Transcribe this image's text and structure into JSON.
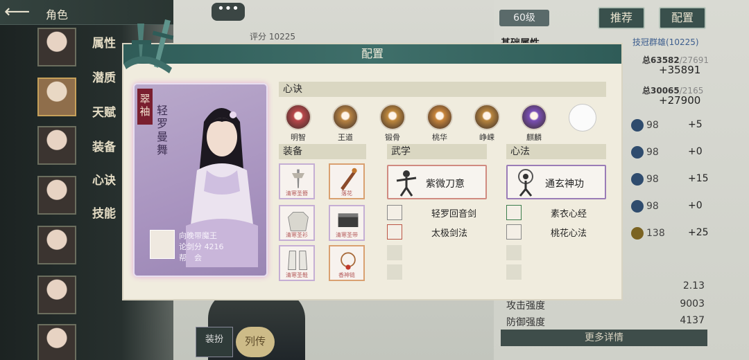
{
  "topbar": {
    "back": "⟵",
    "title": "角色"
  },
  "side_tabs": [
    "属性",
    "潜质",
    "天赋",
    "装备",
    "心诀",
    "技能"
  ],
  "chat": "•••",
  "score_text": "评分 10225",
  "right": {
    "level": "60级",
    "recommend": "推荐",
    "config": "配置",
    "base_attr": "基础属性",
    "champion": "技冠群雄(10225)",
    "total1": "总63582",
    "total1_suffix": "/27691",
    "big1": "+35891",
    "total2": "总30065",
    "total2_suffix": "/2165",
    "big2": "+27900",
    "rows": [
      {
        "val": "98",
        "plus": "+5"
      },
      {
        "val": "98",
        "plus": "+0"
      },
      {
        "val": "98",
        "plus": "+15"
      },
      {
        "val": "98",
        "plus": "+0"
      },
      {
        "val": "138",
        "plus": "+25"
      }
    ],
    "stats": [
      {
        "label": "",
        "value": "2.13"
      },
      {
        "label": "攻击强度",
        "value": "9003"
      },
      {
        "label": "防御强度",
        "value": "4137"
      }
    ],
    "more": "更多详情"
  },
  "bottom": {
    "costume": "装扮",
    "bio": "列传"
  },
  "modal": {
    "title": "配置",
    "character": {
      "title_tag": "翠袖",
      "name": "轻罗曼舞",
      "owner": "向晚带魔王",
      "score": "论剑分 4216",
      "guild": "帮　会"
    },
    "heart_section": "心诀",
    "hearts": [
      {
        "label": "明智",
        "color": "#b8474a"
      },
      {
        "label": "王道",
        "color": "#b98443"
      },
      {
        "label": "锻骨",
        "color": "#c0893d"
      },
      {
        "label": "桃华",
        "color": "#c7843b"
      },
      {
        "label": "峥嵘",
        "color": "#b8853e"
      },
      {
        "label": "麒麟",
        "color": "#7a4fb5"
      }
    ],
    "equip_section": "装备",
    "equipment": [
      {
        "label": "清寒圣簪",
        "icon": "hairpin-icon"
      },
      {
        "label": "落花",
        "icon": "flute-icon"
      },
      {
        "label": "清寒圣衫",
        "icon": "robe-icon"
      },
      {
        "label": "清寒圣带",
        "icon": "belt-icon"
      },
      {
        "label": "清寒圣鞋",
        "icon": "boots-icon"
      },
      {
        "label": "香神链",
        "icon": "necklace-icon"
      }
    ],
    "martial_section": "武学",
    "martial_main": "紫微刀意",
    "martial_skills": [
      "轻罗回音剑",
      "太极剑法"
    ],
    "method_section": "心法",
    "method_main": "通玄神功",
    "method_skills": [
      "素衣心经",
      "桃花心法"
    ]
  }
}
